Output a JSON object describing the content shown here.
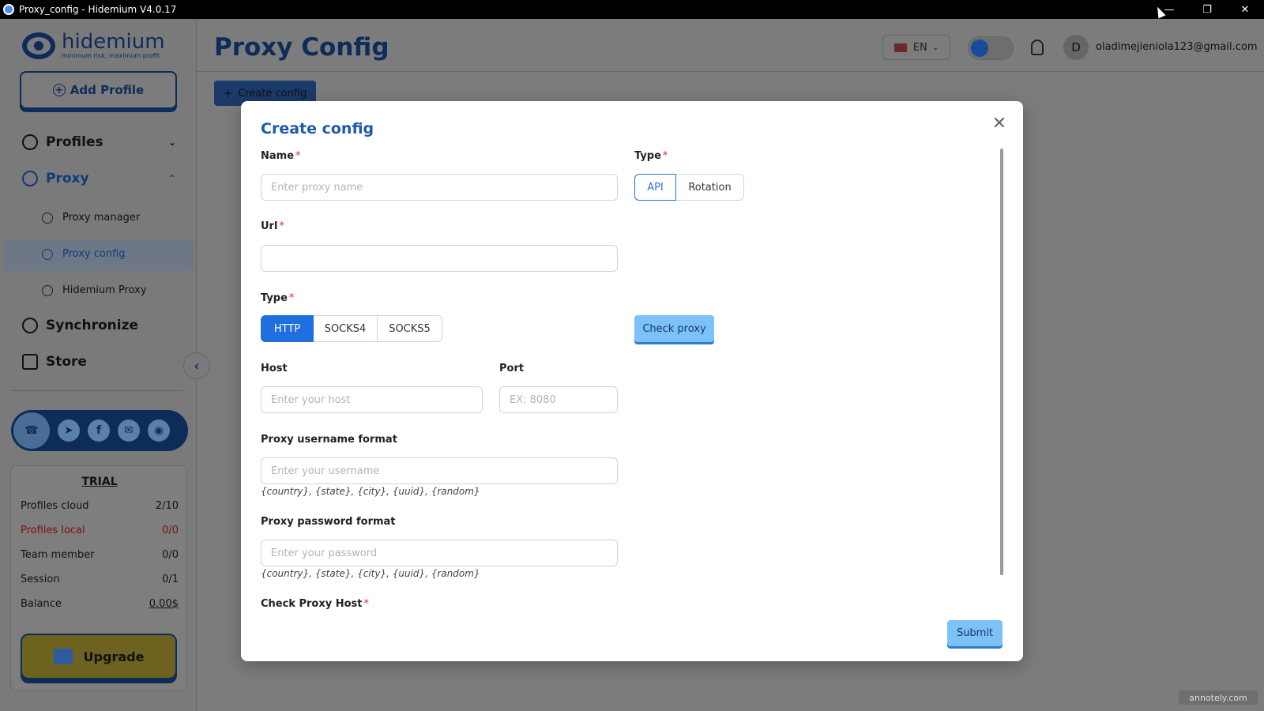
{
  "window": {
    "title": "Proxy_config - Hidemium V4.0.17",
    "controls": [
      "minimize",
      "restore",
      "close"
    ]
  },
  "brand": {
    "name": "hidemium",
    "tagline": "minimum risk, maximum profit"
  },
  "sidebar": {
    "add_profile_label": "Add Profile",
    "items": [
      {
        "label": "Profiles",
        "icon": "profiles-icon"
      },
      {
        "label": "Proxy",
        "icon": "globe-icon"
      },
      {
        "label": "Synchronize",
        "icon": "sync-icon"
      },
      {
        "label": "Store",
        "icon": "store-icon"
      }
    ],
    "proxy_subitems": [
      {
        "label": "Proxy manager",
        "icon": "globe-icon"
      },
      {
        "label": "Proxy config",
        "icon": "globe-icon",
        "active": true
      },
      {
        "label": "Hidemium Proxy",
        "icon": "globe-icon"
      }
    ],
    "social": [
      "support-icon",
      "telegram-icon",
      "facebook-icon",
      "email-icon",
      "website-icon"
    ],
    "plan": {
      "title": "TRIAL",
      "stats": [
        {
          "label": "Profiles cloud",
          "value": "2/10"
        },
        {
          "label": "Profiles local",
          "value": "0/0"
        },
        {
          "label": "Team member",
          "value": "0/0"
        },
        {
          "label": "Session",
          "value": "0/1"
        },
        {
          "label": "Balance",
          "value": "0.00$"
        }
      ],
      "upgrade_label": "Upgrade"
    }
  },
  "header": {
    "title": "Proxy Config",
    "language": "EN",
    "avatar_initial": "D",
    "email": "oladimejieniola123@gmail.com"
  },
  "toolbar": {
    "create_config_label": "Create config"
  },
  "modal": {
    "title": "Create config",
    "name": {
      "label": "Name",
      "placeholder": "Enter proxy name"
    },
    "source_type": {
      "label": "Type",
      "options": [
        "API",
        "Rotation"
      ],
      "selected": "API"
    },
    "url": {
      "label": "Url",
      "value": ""
    },
    "protocol_type": {
      "label": "Type",
      "options": [
        "HTTP",
        "SOCKS4",
        "SOCKS5"
      ],
      "selected": "HTTP"
    },
    "check_proxy_label": "Check proxy",
    "host": {
      "label": "Host",
      "placeholder": "Enter your host"
    },
    "port": {
      "label": "Port",
      "placeholder": "EX: 8080"
    },
    "username_format": {
      "label": "Proxy username format",
      "placeholder": "Enter your username",
      "hint": "{country}, {state}, {city}, {uuid}, {random}"
    },
    "password_format": {
      "label": "Proxy password format",
      "placeholder": "Enter your password",
      "hint": "{country}, {state}, {city}, {uuid}, {random}"
    },
    "check_proxy_host": {
      "label": "Check Proxy Host"
    },
    "submit_label": "Submit"
  },
  "watermark": "annotely.com"
}
